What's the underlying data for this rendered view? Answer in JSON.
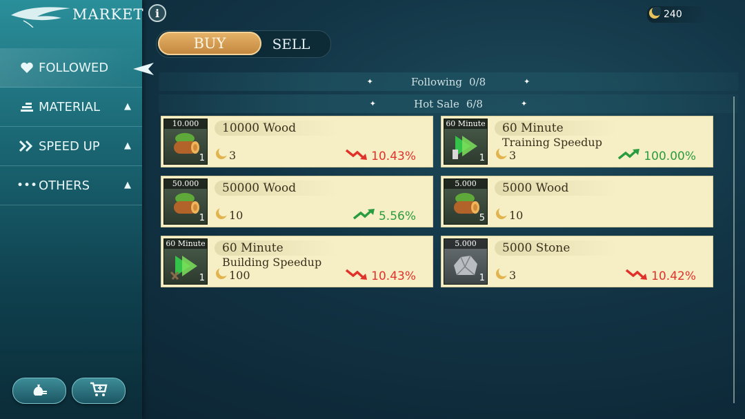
{
  "sidebar": {
    "title": "MARKET",
    "items": [
      {
        "label": "FOLLOWED",
        "icon": "heart-icon"
      },
      {
        "label": "MATERIAL",
        "icon": "stack-icon"
      },
      {
        "label": "SPEED UP",
        "icon": "double-chevron-icon"
      },
      {
        "label": "OTHERS",
        "icon": "dots-icon"
      }
    ]
  },
  "header": {
    "info": "i",
    "currency_amount": "240",
    "buy_label": "BUY",
    "sell_label": "SELL"
  },
  "sections": {
    "following": {
      "label": "Following",
      "count": "0/8"
    },
    "hot_sale": {
      "label": "Hot Sale",
      "count": "6/8"
    }
  },
  "items": [
    {
      "tag": "10.000",
      "count": "1",
      "name": "10000 Wood",
      "name2": "",
      "price": "3",
      "change": "10.43%",
      "direction": "down",
      "icon": "wood-log-icon"
    },
    {
      "tag": "60 Minute",
      "count": "1",
      "name": "60 Minute",
      "name2": "Training Speedup",
      "price": "3",
      "change": "100.00%",
      "direction": "up",
      "icon": "training-speedup-icon"
    },
    {
      "tag": "50.000",
      "count": "1",
      "name": "50000 Wood",
      "name2": "",
      "price": "10",
      "change": "5.56%",
      "direction": "up",
      "icon": "wood-log-icon"
    },
    {
      "tag": "5.000",
      "count": "5",
      "name": "5000 Wood",
      "name2": "",
      "price": "10",
      "change": "",
      "direction": "none",
      "icon": "wood-log-icon"
    },
    {
      "tag": "60 Minute",
      "count": "1",
      "name": "60 Minute",
      "name2": "Building Speedup",
      "price": "100",
      "change": "10.43%",
      "direction": "down",
      "icon": "building-speedup-icon"
    },
    {
      "tag": "5.000",
      "count": "1",
      "name": "5000 Stone",
      "name2": "",
      "price": "3",
      "change": "10.42%",
      "direction": "down",
      "icon": "stone-icon"
    }
  ]
}
